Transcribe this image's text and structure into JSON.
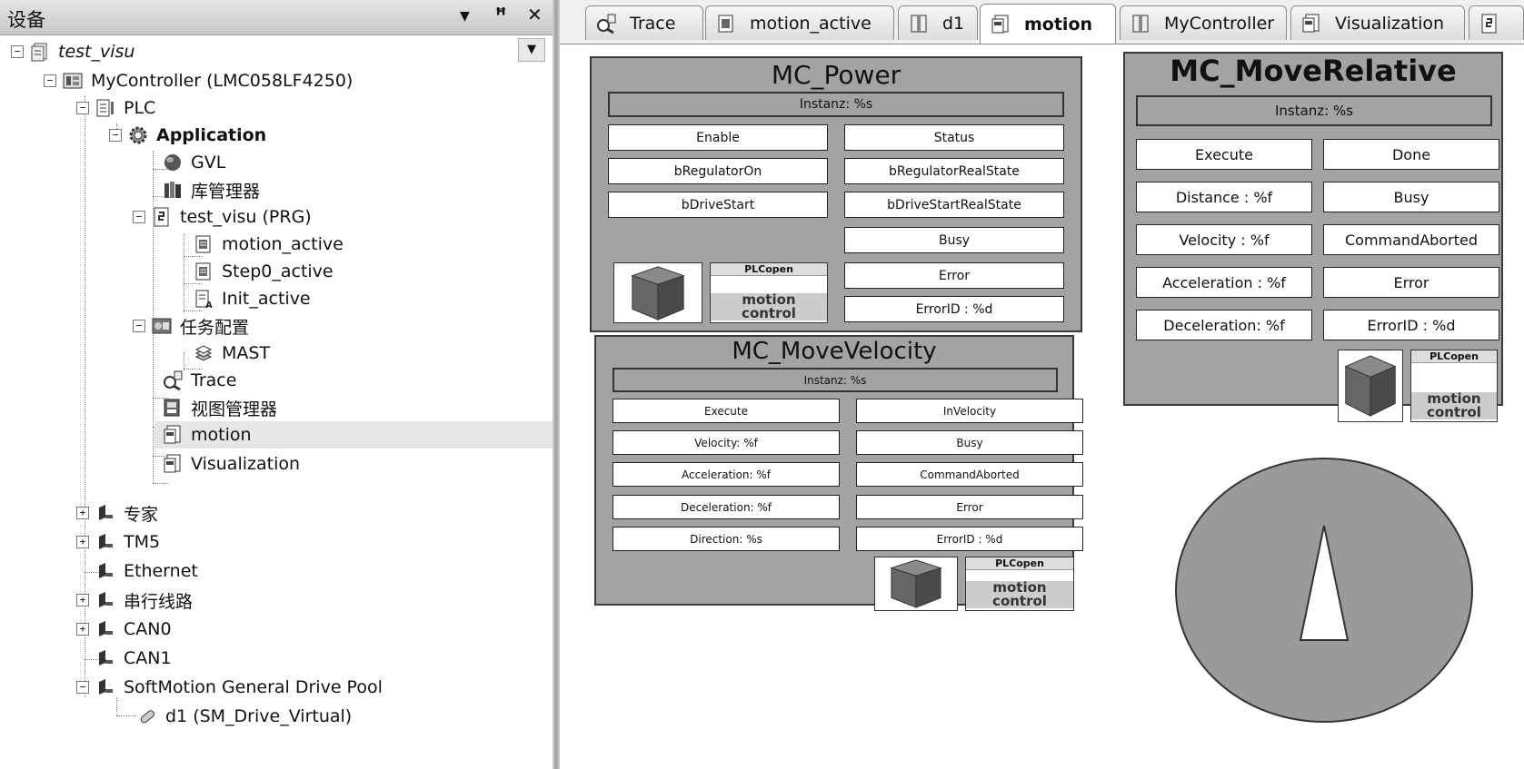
{
  "device_panel": {
    "title": "设备",
    "tree": [
      {
        "label": "test_visu",
        "icon": "project-icon"
      },
      {
        "label": "MyController (LMC058LF4250)",
        "icon": "controller-icon"
      },
      {
        "label": "PLC",
        "icon": "plc-icon"
      },
      {
        "label": "Application",
        "icon": "application-gear-icon"
      },
      {
        "label": "GVL",
        "icon": "gvl-globe-icon"
      },
      {
        "label": "库管理器",
        "icon": "library-manager-icon"
      },
      {
        "label": "test_visu (PRG)",
        "icon": "program-icon"
      },
      {
        "label": "motion_active",
        "icon": "action-icon"
      },
      {
        "label": "Step0_active",
        "icon": "action-icon"
      },
      {
        "label": "Init_active",
        "icon": "action-icon"
      },
      {
        "label": "任务配置",
        "icon": "task-config-icon"
      },
      {
        "label": "MAST",
        "icon": "task-icon"
      },
      {
        "label": "Trace",
        "icon": "trace-icon"
      },
      {
        "label": "视图管理器",
        "icon": "visu-manager-icon"
      },
      {
        "label": "motion",
        "icon": "visualization-icon"
      },
      {
        "label": "Visualization",
        "icon": "visualization-icon"
      },
      {
        "label": "专家",
        "icon": "connector-icon"
      },
      {
        "label": "TM5",
        "icon": "connector-icon"
      },
      {
        "label": "Ethernet",
        "icon": "connector-icon"
      },
      {
        "label": "串行线路",
        "icon": "connector-icon"
      },
      {
        "label": "CAN0",
        "icon": "connector-icon"
      },
      {
        "label": "CAN1",
        "icon": "connector-icon"
      },
      {
        "label": "SoftMotion General Drive Pool",
        "icon": "connector-icon"
      },
      {
        "label": "d1 (SM_Drive_Virtual)",
        "icon": "drive-icon"
      }
    ]
  },
  "tabs": [
    {
      "label": "Trace",
      "icon": "trace-icon"
    },
    {
      "label": "motion_active",
      "icon": "action-icon"
    },
    {
      "label": "d1",
      "icon": "drive-page-icon"
    },
    {
      "label": "motion",
      "icon": "visualization-icon",
      "active": true
    },
    {
      "label": "MyController",
      "icon": "controller-page-icon"
    },
    {
      "label": "Visualization",
      "icon": "visualization-icon"
    }
  ],
  "fb_power": {
    "title": "MC_Power",
    "instance": "Instanz: %s",
    "inputs": [
      "Enable",
      "bRegulatorOn",
      "bDriveStart"
    ],
    "outputs": [
      "Status",
      "bRegulatorRealState",
      "bDriveStartRealState",
      "Busy",
      "Error",
      "ErrorID : %d"
    ]
  },
  "fb_velocity": {
    "title": "MC_MoveVelocity",
    "instance": "Instanz: %s",
    "inputs": [
      "Execute",
      "Velocity: %f",
      "Acceleration: %f",
      "Deceleration: %f",
      "Direction: %s"
    ],
    "outputs": [
      "InVelocity",
      "Busy",
      "CommandAborted",
      "Error",
      "ErrorID : %d"
    ]
  },
  "fb_relative": {
    "title": "MC_MoveRelative",
    "instance": "Instanz: %s",
    "inputs": [
      "Execute",
      "Distance : %f",
      "Velocity : %f",
      "Acceleration : %f",
      "Deceleration: %f"
    ],
    "outputs": [
      "Done",
      "Busy",
      "CommandAborted",
      "Error",
      "ErrorID : %d"
    ]
  },
  "plcopen_logo": {
    "top": "PLCopen",
    "bottom1": "motion",
    "bottom2": "control"
  },
  "colors": {
    "fb_fill": "#a3a3a3",
    "pie_fill": "#9a9a9a",
    "selected_row": "#e6e6e6"
  }
}
